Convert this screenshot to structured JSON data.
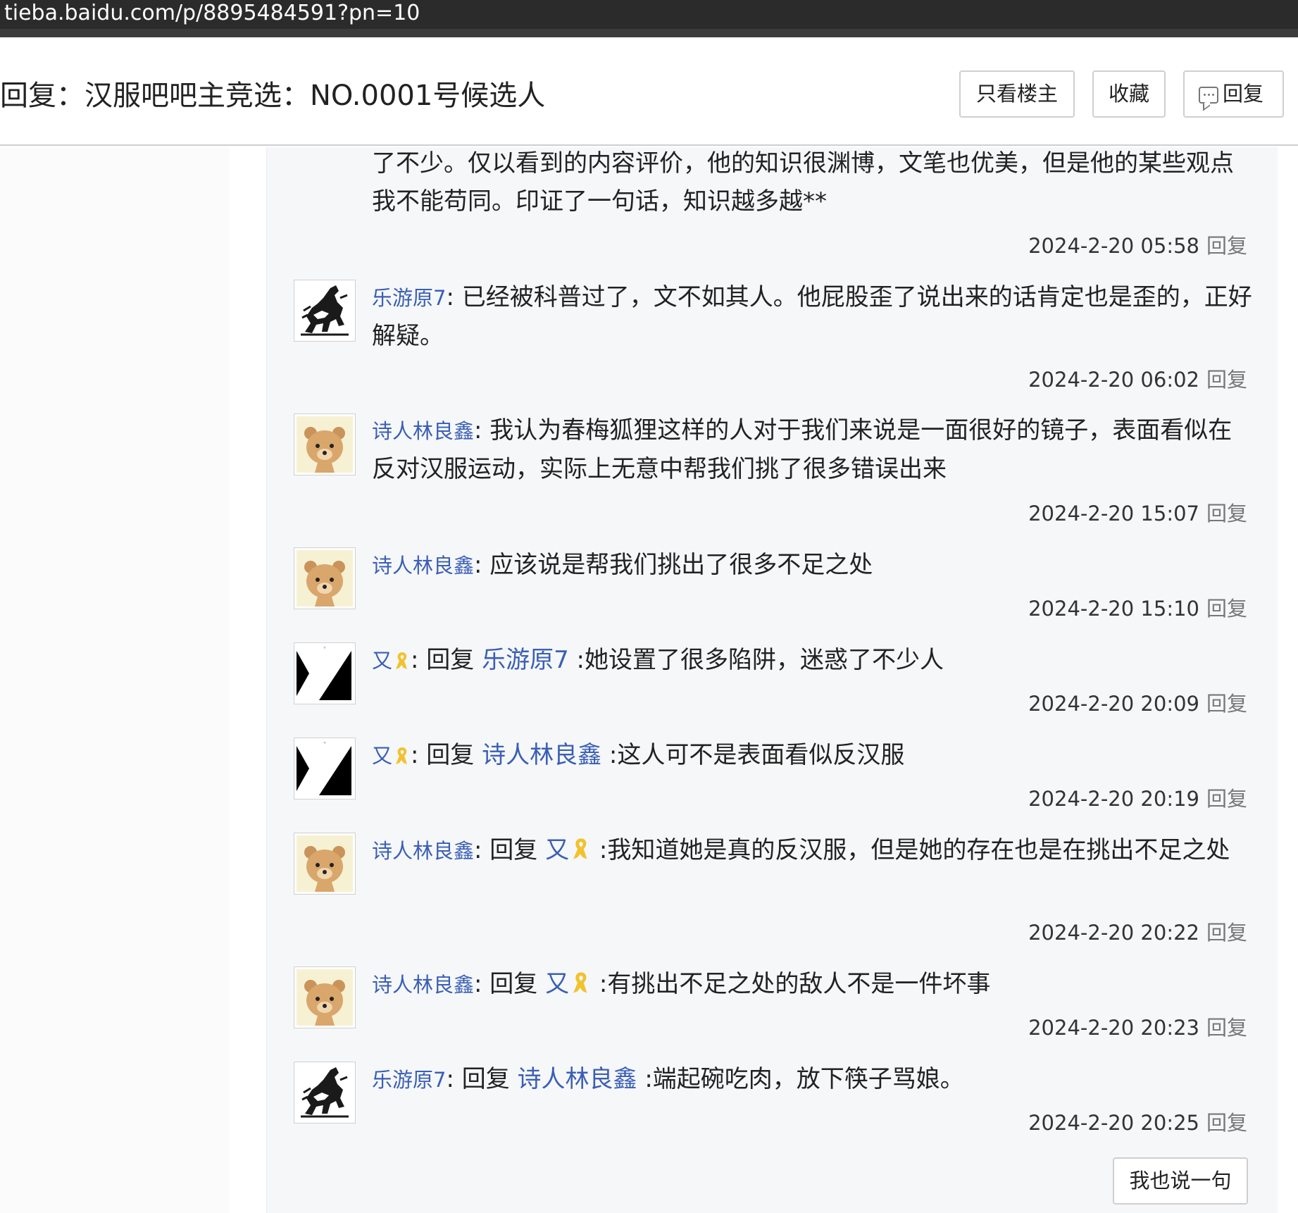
{
  "browser": {
    "url": "tieba.baidu.com/p/8895484591?pn=10"
  },
  "header": {
    "title": "回复：汉服吧吧主竞选：NO.0001号候选人",
    "only_owner_label": "只看楼主",
    "favorite_label": "收藏",
    "reply_label": "回复"
  },
  "reply_link_label": "回复",
  "reply_prefix": "回复",
  "comments": [
    {
      "user": "",
      "content": "了不少。仅以看到的内容评价，他的知识很渊博，文笔也优美，但是他的某些观点我不能苟同。印证了一句话，知识越多越**",
      "time": "2024-2-20 05:58"
    },
    {
      "user": "乐游原7",
      "avatar": "horse-drawing-avatar",
      "content": "已经被科普过了，文不如其人。他屁股歪了说出来的话肯定也是歪的，正好解疑。",
      "time": "2024-2-20 06:02"
    },
    {
      "user": "诗人林良鑫",
      "avatar": "bear-avatar",
      "content": "我认为春梅狐狸这样的人对于我们来说是一面很好的镜子，表面看似在反对汉服运动，实际上无意中帮我们挑了很多错误出来",
      "time": "2024-2-20 15:07"
    },
    {
      "user": "诗人林良鑫",
      "avatar": "bear-avatar",
      "content": "应该说是帮我们挑出了很多不足之处",
      "time": "2024-2-20 15:10"
    },
    {
      "user": "又",
      "avatar": "black-white-avatar",
      "target": "乐游原7",
      "content": ":她设置了很多陷阱，迷惑了不少人",
      "time": "2024-2-20 20:09"
    },
    {
      "user": "又",
      "avatar": "black-white-avatar",
      "target": "诗人林良鑫",
      "content": ":这人可不是表面看似反汉服",
      "time": "2024-2-20 20:19"
    },
    {
      "user": "诗人林良鑫",
      "avatar": "bear-avatar",
      "target": "又",
      "content": ":我知道她是真的反汉服，但是她的存在也是在挑出不足之处",
      "time": "2024-2-20 20:22"
    },
    {
      "user": "诗人林良鑫",
      "avatar": "bear-avatar",
      "target": "又",
      "content": ":有挑出不足之处的敌人不是一件坏事",
      "time": "2024-2-20 20:23"
    },
    {
      "user": "乐游原7",
      "avatar": "horse-drawing-avatar",
      "target": "诗人林良鑫",
      "content": ":端起碗吃肉，放下筷子骂娘。",
      "time": "2024-2-20 20:25"
    }
  ],
  "say_button_label": "我也说一句",
  "colors": {
    "link": "#3a5fb4",
    "ribbon": "#f2c22e",
    "thread_bg": "#f6f7f9"
  }
}
